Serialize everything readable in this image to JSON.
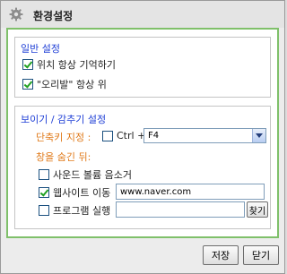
{
  "window": {
    "title": "환경설정"
  },
  "general": {
    "title": "일반 설정",
    "remember_position": {
      "label": "위치 항상 기억하기",
      "checked": true
    },
    "always_on_top": {
      "label": "\"오리발\" 항상 위",
      "checked": true
    }
  },
  "showhide": {
    "title": "보이기 / 감추기 설정",
    "hotkey_label": "단축키 지정 :",
    "ctrl": {
      "label": "Ctrl +",
      "checked": false
    },
    "key_select": {
      "value": "F4"
    },
    "hide_label": "창을 숨긴 뒤:",
    "mute": {
      "label": "사운드 볼륨 음소거",
      "checked": false
    },
    "go_website": {
      "label": "웹사이트 이동",
      "checked": true,
      "url": "www.naver.com"
    },
    "run_program": {
      "label": "프로그램 실행",
      "checked": false,
      "path": "",
      "browse_label": "찾기"
    }
  },
  "footer": {
    "save_label": "저장",
    "close_label": "닫기"
  },
  "colors": {
    "accent_border": "#7fc06a",
    "group_title": "#1f3fd6",
    "orange_label": "#e07a1a"
  }
}
